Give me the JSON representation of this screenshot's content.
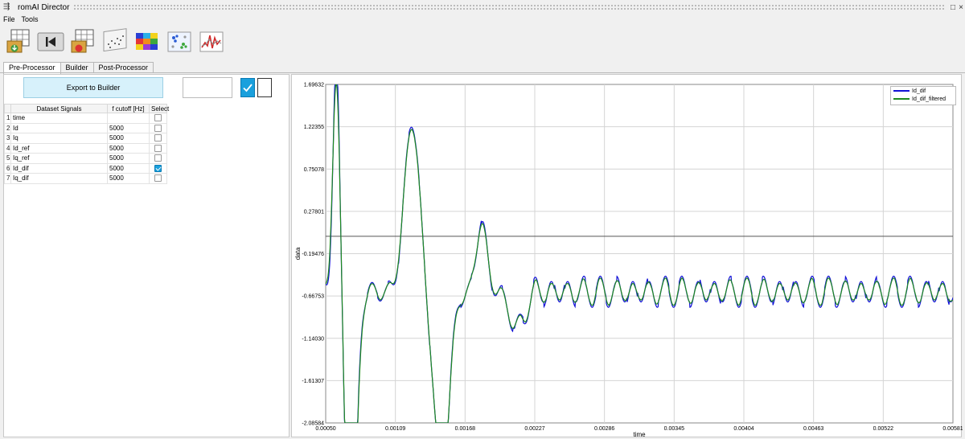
{
  "window": {
    "title": "romAI Director",
    "maximize_glyph": "□",
    "close_glyph": "×"
  },
  "menu": [
    {
      "label": "File"
    },
    {
      "label": "Tools"
    }
  ],
  "toolbar": {
    "icons": [
      "import-dataset-icon",
      "go-to-start-icon",
      "dataset-export-icon",
      "scatter-plot-icon",
      "heatmap-icon",
      "cluster-plot-icon",
      "signal-plot-icon"
    ]
  },
  "tabs": [
    {
      "label": "Pre-Processor",
      "active": true
    },
    {
      "label": "Builder"
    },
    {
      "label": "Post-Processor"
    }
  ],
  "preprocessor": {
    "export_label": "Export to Builder",
    "table": {
      "headers": [
        "Dataset Signals",
        "f cutoff [Hz]",
        "Select"
      ],
      "rows": [
        {
          "n": "1",
          "signal": "time",
          "cutoff": "",
          "selected": false
        },
        {
          "n": "2",
          "signal": "Id",
          "cutoff": "5000",
          "selected": false
        },
        {
          "n": "3",
          "signal": "Iq",
          "cutoff": "5000",
          "selected": false
        },
        {
          "n": "4",
          "signal": "Id_ref",
          "cutoff": "5000",
          "selected": false
        },
        {
          "n": "5",
          "signal": "Iq_ref",
          "cutoff": "5000",
          "selected": false
        },
        {
          "n": "6",
          "signal": "Id_dif",
          "cutoff": "5000",
          "selected": true
        },
        {
          "n": "7",
          "signal": "Iq_dif",
          "cutoff": "5000",
          "selected": false
        }
      ]
    }
  },
  "plot": {
    "xlabel": "time",
    "ylabel": "data",
    "xlim": [
      0.0005,
      0.00581
    ],
    "ylim": [
      -2.08584,
      1.69632
    ],
    "x_ticks": [
      "0.00050",
      "0.00109",
      "0.00168",
      "0.00227",
      "0.00286",
      "0.00345",
      "0.00404",
      "0.00463",
      "0.00522",
      "0.00581"
    ],
    "y_ticks": [
      "1.69632",
      "1.22355",
      "0.75078",
      "0.27801",
      "-0.19476",
      "-0.66753",
      "-1.14030",
      "-1.61307",
      "-2.08584"
    ],
    "zero_line": 0.0,
    "series": [
      {
        "name": "Id_dif",
        "color": "#1212d6"
      },
      {
        "name": "Id_dif_filtered",
        "color": "#1e8a1e"
      }
    ]
  }
}
